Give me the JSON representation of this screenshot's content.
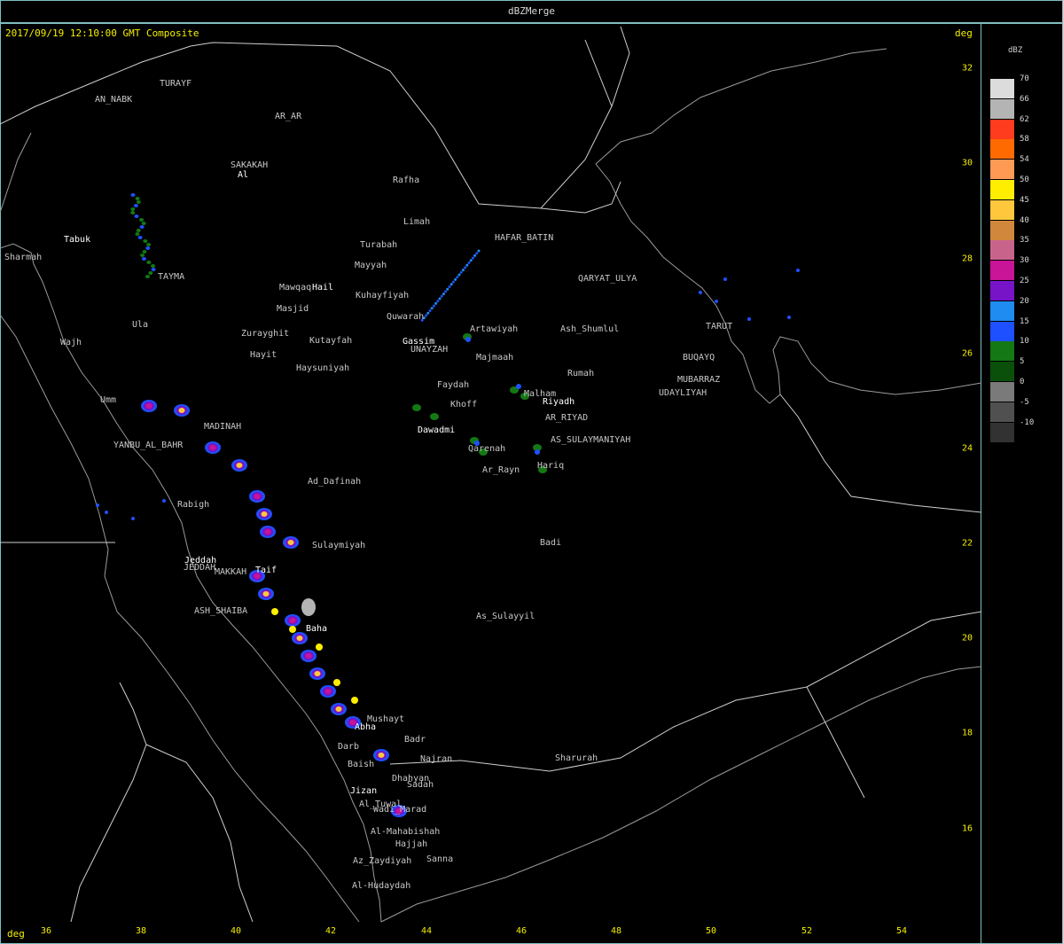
{
  "window": {
    "title": "dBZMerge"
  },
  "header": {
    "subtitle": "2017/09/19 12:10:00 GMT Composite",
    "deg_top": "deg",
    "deg_bottom": "deg"
  },
  "axes": {
    "lon_ticks": [
      "36",
      "38",
      "40",
      "42",
      "44",
      "46",
      "48",
      "50",
      "52",
      "54"
    ],
    "lat_ticks": [
      "32",
      "30",
      "28",
      "26",
      "24",
      "22",
      "20",
      "18",
      "16"
    ]
  },
  "legend": {
    "title": "dBZ",
    "entries": [
      {
        "label": "70",
        "color": "#dcdcdc"
      },
      {
        "label": "66",
        "color": "#b4b4b4"
      },
      {
        "label": "62",
        "color": "#ff3c1e"
      },
      {
        "label": "58",
        "color": "#ff6a00"
      },
      {
        "label": "54",
        "color": "#ff9a55"
      },
      {
        "label": "50",
        "color": "#ffee00"
      },
      {
        "label": "45",
        "color": "#ffc83c"
      },
      {
        "label": "40",
        "color": "#d2883c"
      },
      {
        "label": "35",
        "color": "#c8648c"
      },
      {
        "label": "30",
        "color": "#c81496"
      },
      {
        "label": "25",
        "color": "#7814c8"
      },
      {
        "label": "20",
        "color": "#1e8cf0"
      },
      {
        "label": "15",
        "color": "#1e50ff"
      },
      {
        "label": "10",
        "color": "#147814"
      },
      {
        "label": "5",
        "color": "#0a500a"
      },
      {
        "label": "0",
        "color": "#7a7a7a"
      },
      {
        "label": "-5",
        "color": "#505050"
      },
      {
        "label": "-10",
        "color": "#323232"
      }
    ]
  },
  "cities": [
    {
      "name": "TURAYF"
    },
    {
      "name": "AN_NABK"
    },
    {
      "name": "AR_AR"
    },
    {
      "name": "SAKAKAH"
    },
    {
      "name": "Al"
    },
    {
      "name": "Rafha"
    },
    {
      "name": "Limah"
    },
    {
      "name": "HAFAR_BATIN"
    },
    {
      "name": "Turabah"
    },
    {
      "name": "Mayyah"
    },
    {
      "name": "Tabuk"
    },
    {
      "name": "Sharmah"
    },
    {
      "name": "TAYMA"
    },
    {
      "name": "Mawqaq"
    },
    {
      "name": "Hail"
    },
    {
      "name": "Kuhayfiyah"
    },
    {
      "name": "Masjid"
    },
    {
      "name": "Quwarah"
    },
    {
      "name": "Ula"
    },
    {
      "name": "Zurayghit"
    },
    {
      "name": "Kutayfah"
    },
    {
      "name": "Gassim"
    },
    {
      "name": "UNAYZAH"
    },
    {
      "name": "Artawiyah"
    },
    {
      "name": "Ash_Shumlul"
    },
    {
      "name": "QARYAT_ULYA"
    },
    {
      "name": "TARUT"
    },
    {
      "name": "Wajh"
    },
    {
      "name": "Hayit"
    },
    {
      "name": "Haysuniyah"
    },
    {
      "name": "Majmaah"
    },
    {
      "name": "BUQAYQ"
    },
    {
      "name": "Rumah"
    },
    {
      "name": "MUBARRAZ"
    },
    {
      "name": "UDAYLIYAH"
    },
    {
      "name": "Faydah"
    },
    {
      "name": "Malham"
    },
    {
      "name": "Riyadh"
    },
    {
      "name": "Umm"
    },
    {
      "name": "Khoff"
    },
    {
      "name": "AR_RIYAD"
    },
    {
      "name": "MADINAH"
    },
    {
      "name": "Dawadmi"
    },
    {
      "name": "AS_SULAYMANIYAH"
    },
    {
      "name": "YANBU_AL_BAHR"
    },
    {
      "name": "Qarenah"
    },
    {
      "name": "Hariq"
    },
    {
      "name": "Ar_Rayn"
    },
    {
      "name": "Ad_Dafinah"
    },
    {
      "name": "Rabigh"
    },
    {
      "name": "Badi"
    },
    {
      "name": "Sulaymiyah"
    },
    {
      "name": "Jeddah"
    },
    {
      "name": "JEDDAH"
    },
    {
      "name": "MAKKAH"
    },
    {
      "name": "Taif"
    },
    {
      "name": "ASH_SHAIBA"
    },
    {
      "name": "As_Sulayyil"
    },
    {
      "name": "Baha"
    },
    {
      "name": "Mushayt"
    },
    {
      "name": "Abha"
    },
    {
      "name": "Badr"
    },
    {
      "name": "Darb"
    },
    {
      "name": "Najran"
    },
    {
      "name": "Sharurah"
    },
    {
      "name": "Baish"
    },
    {
      "name": "Dhahyan"
    },
    {
      "name": "Sadah"
    },
    {
      "name": "Jizan"
    },
    {
      "name": "Al_Tuwal"
    },
    {
      "name": "Wadi_Marad"
    },
    {
      "name": "Al-Mahabishah"
    },
    {
      "name": "Hajjah"
    },
    {
      "name": "Sanna"
    },
    {
      "name": "Az_Zaydiyah"
    },
    {
      "name": "Al-Hudaydah"
    }
  ]
}
